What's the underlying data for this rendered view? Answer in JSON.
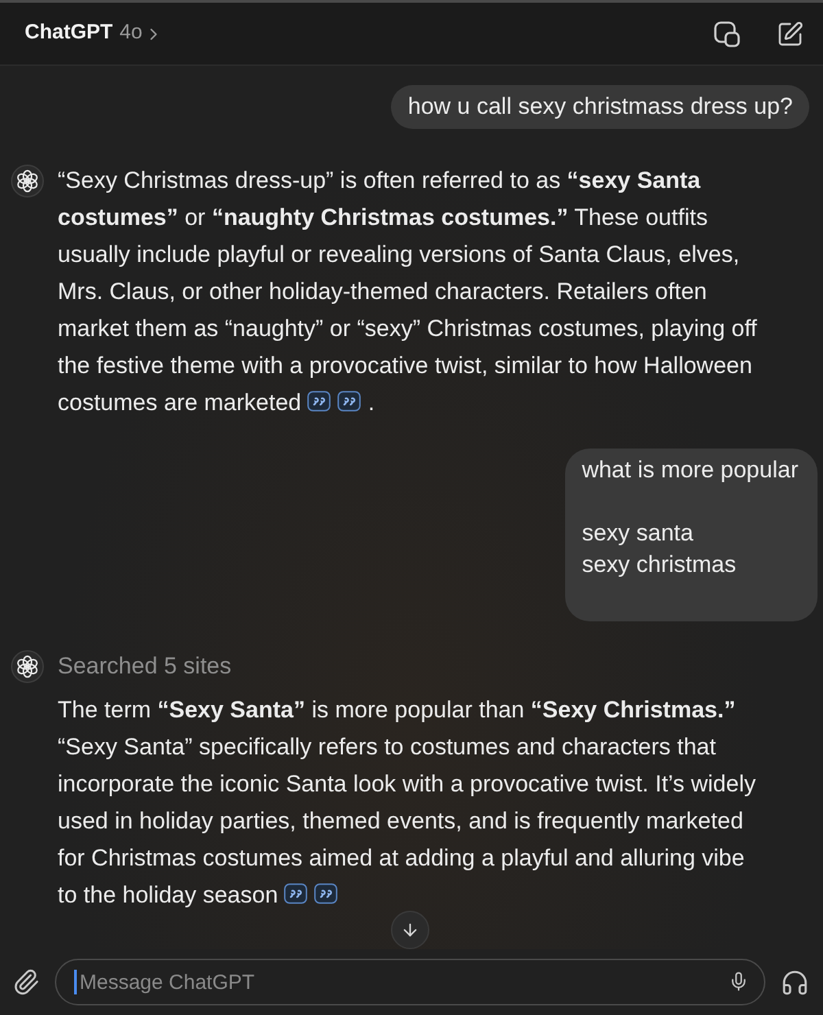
{
  "header": {
    "title": "ChatGPT",
    "model": "4o"
  },
  "messages": [
    {
      "kind": "user",
      "text": "how u call sexy christmass dress up?"
    },
    {
      "kind": "assistant",
      "text": "“Sexy Christmas dress-up” is often referred to as **“sexy Santa costumes”** or **“naughty Christmas costumes.”** These outfits usually include playful or revealing versions of Santa Claus, elves, Mrs. Claus, or other holiday-themed characters. Retailers often market them as “naughty” or “sexy” Christmas costumes, playing off the festive theme with a provocative twist, similar to how Halloween costumes are marketed",
      "citations": [
        {
          "kind": "quote"
        },
        {
          "kind": "quote"
        }
      ],
      "end": "."
    },
    {
      "kind": "user",
      "text": "what is more popular\n\nsexy santa\nsexy christmas"
    },
    {
      "kind": "assistant",
      "status": "Searched 5 sites",
      "text": "The term **“Sexy Santa”** is more popular than **“Sexy Christmas.”** “Sexy Santa” specifically refers to costumes and characters that incorporate the iconic Santa look with a provocative twist. It’s widely used in holiday parties, themed events, and is frequently marketed for Christmas costumes aimed at adding a playful and alluring vibe to the holiday season",
      "citations": [
        {
          "kind": "quote"
        },
        {
          "kind": "quote"
        }
      ]
    }
  ],
  "composer": {
    "placeholder": "Message ChatGPT"
  }
}
